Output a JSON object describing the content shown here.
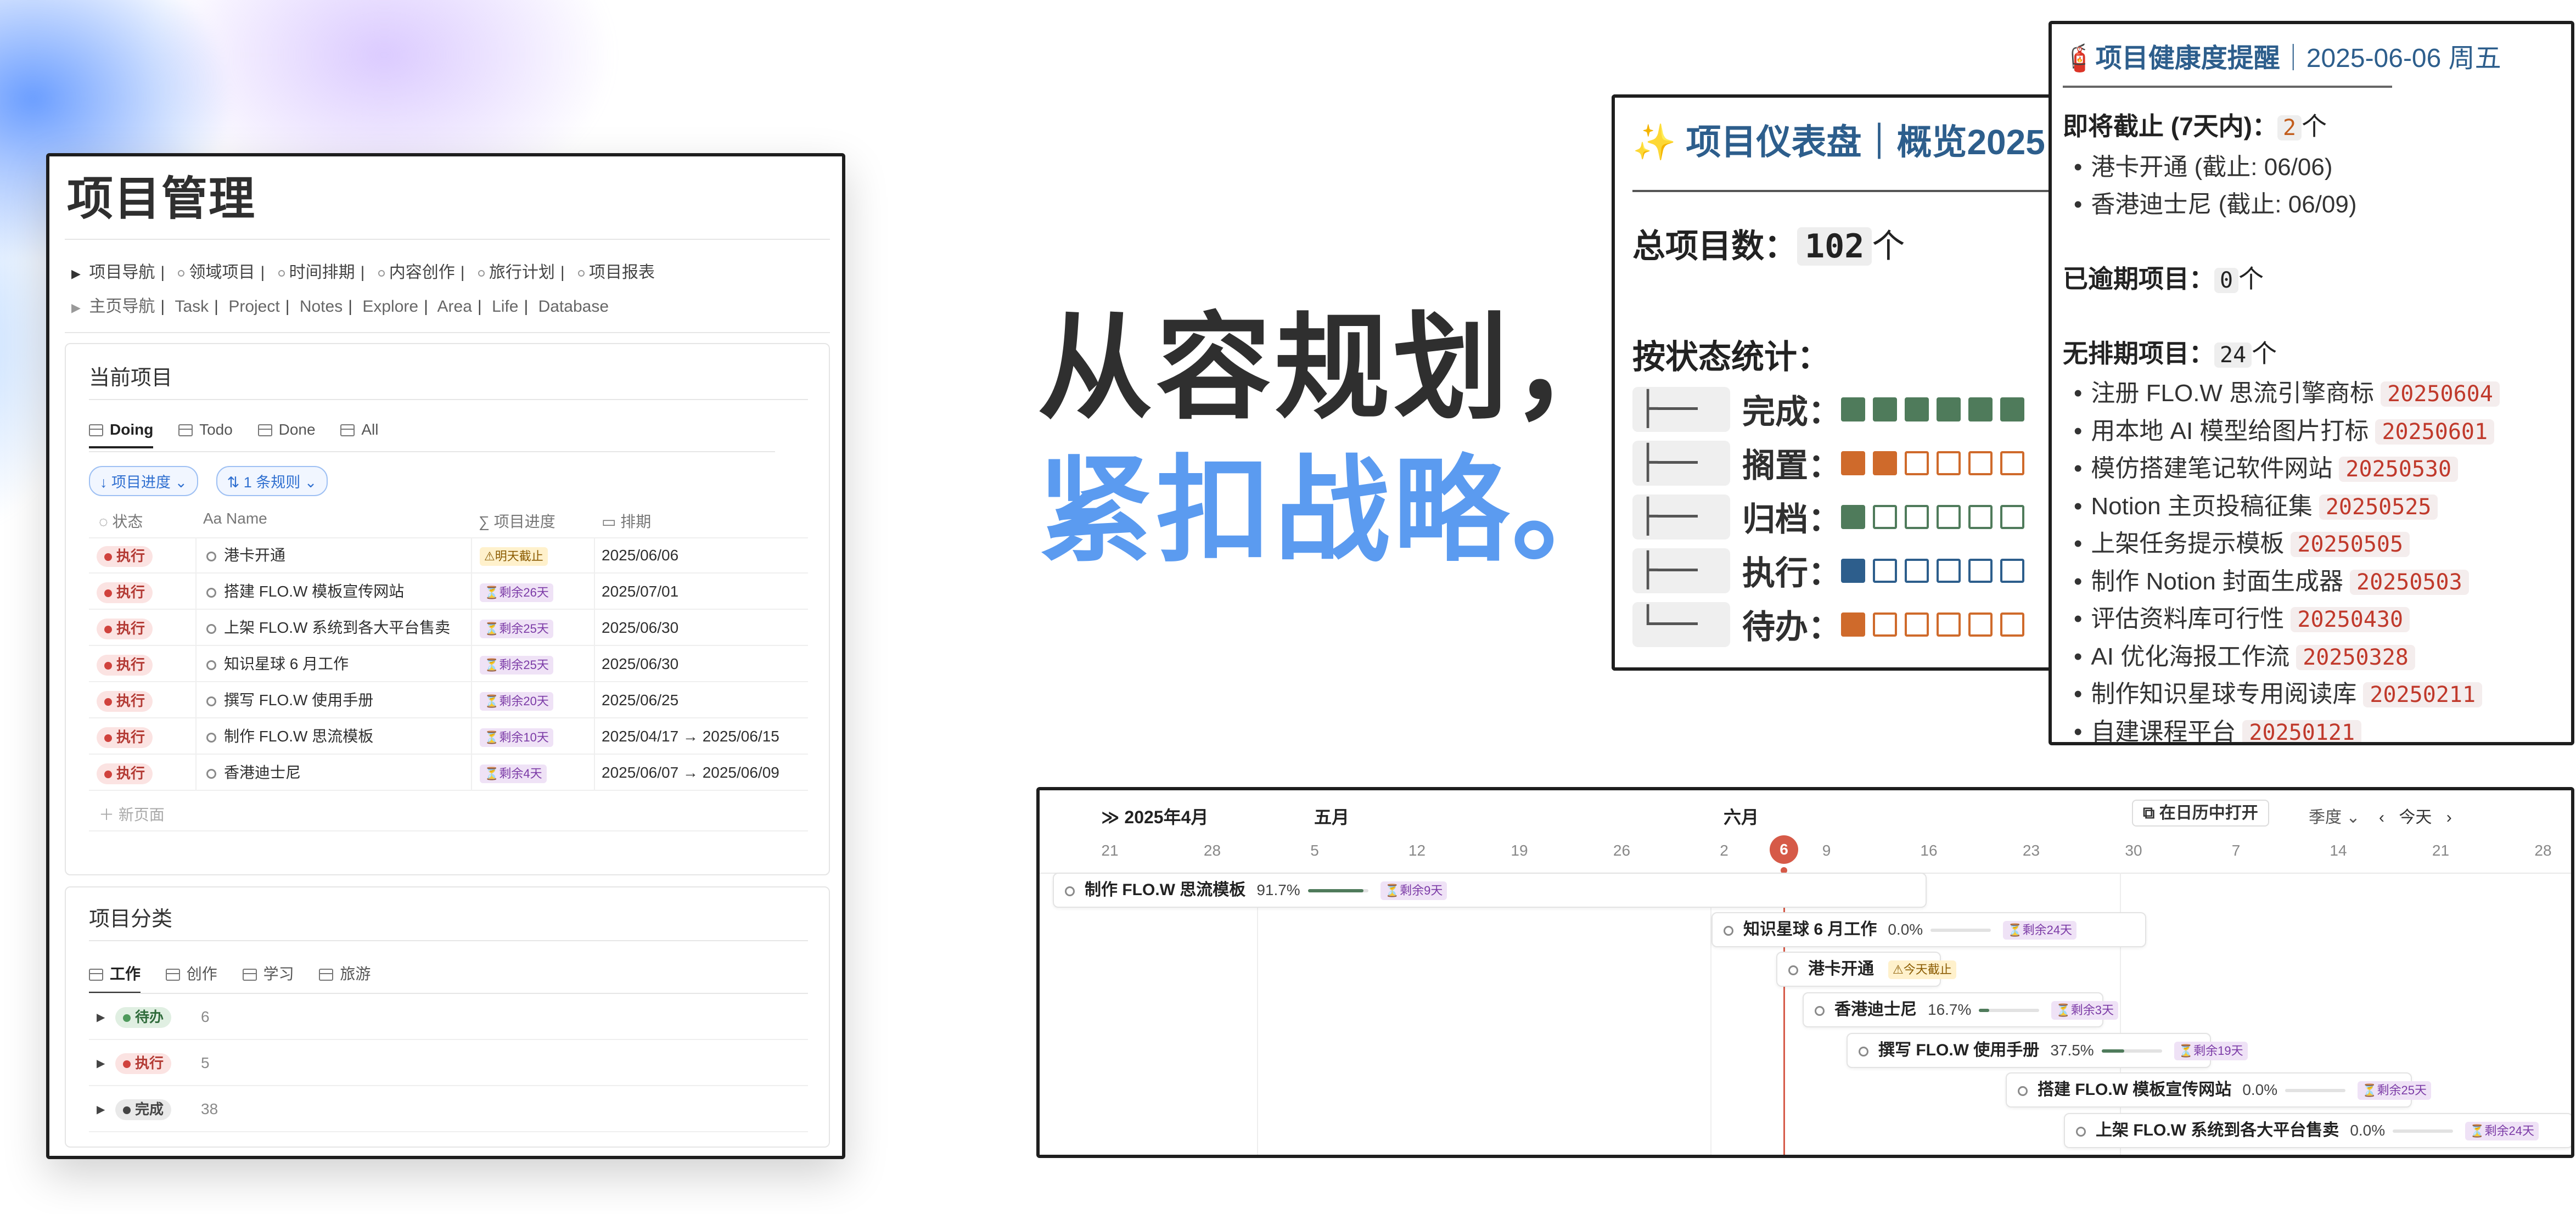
{
  "headline": {
    "line1": "从容规划，",
    "line2": "紧扣战略。"
  },
  "pm": {
    "title": "项目管理",
    "nav1": [
      "项目导航",
      "领域项目",
      "时间排期",
      "内容创作",
      "旅行计划",
      "项目报表"
    ],
    "nav2": [
      "主页导航",
      "Task",
      "Project",
      "Notes",
      "Explore",
      "Area",
      "Life",
      "Database"
    ],
    "current": {
      "title": "当前项目",
      "tabs": [
        "Doing",
        "Todo",
        "Done",
        "All"
      ],
      "filters": [
        "↓ 项目进度 ⌄",
        "⇅ 1 条规则 ⌄"
      ],
      "headers": [
        "状态",
        "Name",
        "项目进度",
        "排期"
      ],
      "rows": [
        {
          "status": "执行",
          "name": "港卡开通",
          "badge": "⚠明天截止",
          "badge_type": "yellow",
          "date": "2025/06/06"
        },
        {
          "status": "执行",
          "name": "搭建 FLO.W 模板宣传网站",
          "badge": "⏳剩余26天",
          "badge_type": "purple",
          "date": "2025/07/01"
        },
        {
          "status": "执行",
          "name": "上架 FLO.W 系统到各大平台售卖",
          "badge": "⏳剩余25天",
          "badge_type": "purple",
          "date": "2025/06/30"
        },
        {
          "status": "执行",
          "name": "知识星球 6 月工作",
          "badge": "⏳剩余25天",
          "badge_type": "purple",
          "date": "2025/06/30"
        },
        {
          "status": "执行",
          "name": "撰写 FLO.W 使用手册",
          "badge": "⏳剩余20天",
          "badge_type": "purple",
          "date": "2025/06/25"
        },
        {
          "status": "执行",
          "name": "制作 FLO.W 思流模板",
          "badge": "⏳剩余10天",
          "badge_type": "purple",
          "date": "2025/04/17 → 2025/06/15"
        },
        {
          "status": "执行",
          "name": "香港迪士尼",
          "badge": "⏳剩余4天",
          "badge_type": "purple",
          "date": "2025/06/07 → 2025/06/09"
        }
      ],
      "new_page": "＋ 新页面"
    },
    "category": {
      "title": "项目分类",
      "tabs": [
        "工作",
        "创作",
        "学习",
        "旅游"
      ],
      "groups": [
        {
          "label": "待办",
          "count": "6"
        },
        {
          "label": "执行",
          "count": "5"
        },
        {
          "label": "完成",
          "count": "38"
        }
      ]
    }
  },
  "dashboard": {
    "title": "✨ 项目仪表盘｜概览2025",
    "total_label": "总项目数：",
    "total_value": "102",
    "total_unit": "个",
    "by_status_label": "按状态统计：",
    "rows": [
      {
        "glyph": "├──",
        "label": "完成：",
        "filled": 6,
        "color": "#4f7b5b"
      },
      {
        "glyph": "├──",
        "label": "搁置：",
        "filled": 2,
        "color": "#cf6a2b"
      },
      {
        "glyph": "├──",
        "label": "归档：",
        "filled": 1,
        "color": "#4f7b5b"
      },
      {
        "glyph": "├──",
        "label": "执行：",
        "filled": 1,
        "color": "#2d5e8c"
      },
      {
        "glyph": "└──",
        "label": "待办：",
        "filled": 1,
        "color": "#cf6a2b"
      }
    ]
  },
  "health": {
    "icon": "🧯",
    "title": "项目健康度提醒",
    "date": "｜2025-06-06 周五",
    "due_label": "即将截止 (7天内)：",
    "due_count": "2",
    "due_items": [
      "港卡开通 (截止: 06/06)",
      "香港迪士尼 (截止: 06/09)"
    ],
    "overdue_label": "已逾期项目：",
    "overdue_count": "0",
    "unsched_label": "无排期项目：",
    "unsched_count": "24",
    "unit": "个",
    "unsched_items": [
      {
        "name": "注册 FLO.W 思流引擎商标",
        "date": "20250604"
      },
      {
        "name": "用本地 AI 模型给图片打标",
        "date": "20250601"
      },
      {
        "name": "模仿搭建笔记软件网站",
        "date": "20250530"
      },
      {
        "name": "Notion 主页投稿征集",
        "date": "20250525"
      },
      {
        "name": "上架任务提示模板",
        "date": "20250505"
      },
      {
        "name": "制作 Notion 封面生成器",
        "date": "20250503"
      },
      {
        "name": "评估资料库可行性",
        "date": "20250430"
      },
      {
        "name": "AI 优化海报工作流",
        "date": "20250328"
      },
      {
        "name": "制作知识星球专用阅读库",
        "date": "20250211"
      },
      {
        "name": "自建课程平台",
        "date": "20250121"
      }
    ]
  },
  "timeline": {
    "months": [
      "≫ 2025年4月",
      "五月",
      "六月"
    ],
    "days": [
      "21",
      "28",
      "5",
      "12",
      "19",
      "26",
      "2",
      "9",
      "16",
      "23",
      "30",
      "7",
      "14",
      "21",
      "28"
    ],
    "today": "6",
    "open_btn": "⧉ 在日历中打开",
    "range": "季度 ⌄",
    "today_btn": "今天",
    "bars": [
      {
        "name": "制作 FLO.W 思流模板",
        "pct": "91.7%",
        "progress": 0.917,
        "badge": "⏳剩余9天",
        "badge_type": "purple"
      },
      {
        "name": "知识星球 6 月工作",
        "pct": "0.0%",
        "progress": 0.0,
        "badge": "⏳剩余24天",
        "badge_type": "purple"
      },
      {
        "name": "港卡开通",
        "pct": "",
        "progress": null,
        "badge": "⚠今天截止",
        "badge_type": "yellow"
      },
      {
        "name": "香港迪士尼",
        "pct": "16.7%",
        "progress": 0.167,
        "badge": "⏳剩余3天",
        "badge_type": "purple"
      },
      {
        "name": "撰写 FLO.W 使用手册",
        "pct": "37.5%",
        "progress": 0.375,
        "badge": "⏳剩余19天",
        "badge_type": "purple"
      },
      {
        "name": "搭建 FLO.W 模板宣传网站",
        "pct": "0.0%",
        "progress": 0.0,
        "badge": "⏳剩余25天",
        "badge_type": "purple"
      },
      {
        "name": "上架 FLO.W 系统到各大平台售卖",
        "pct": "0.0%",
        "progress": 0.0,
        "badge": "⏳剩余24天",
        "badge_type": "purple"
      }
    ]
  }
}
